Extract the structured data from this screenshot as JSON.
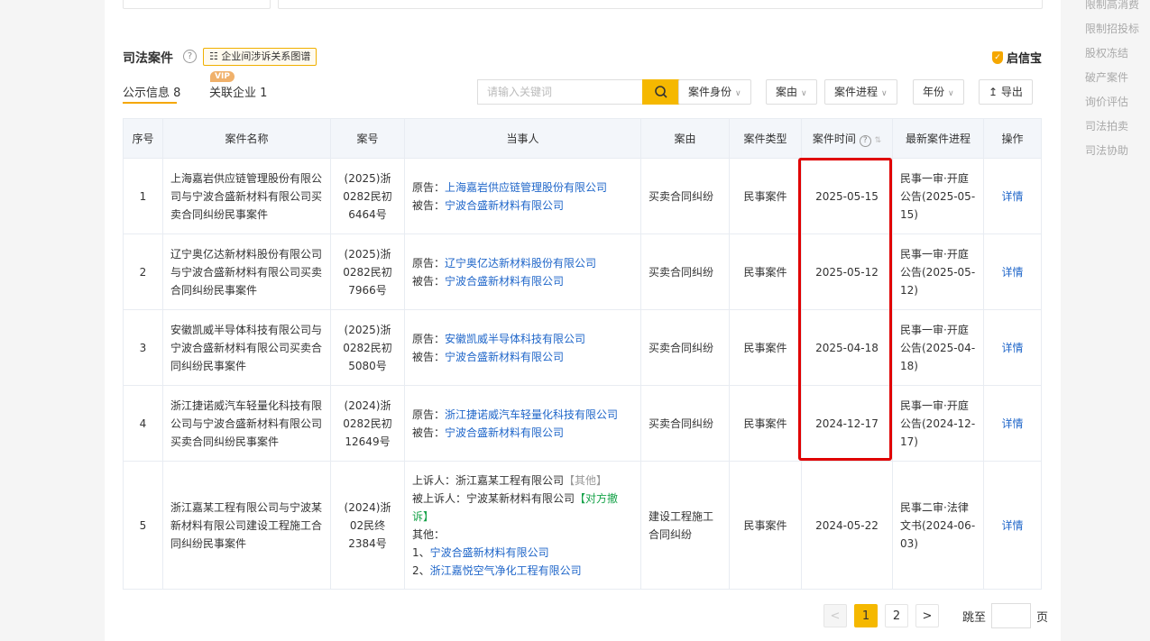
{
  "section": {
    "title": "司法案件",
    "relation_button": "企业间涉诉关系图谱",
    "brand": "启信宝"
  },
  "tabs": [
    {
      "label": "公示信息",
      "count": "8"
    },
    {
      "label": "关联企业",
      "count": "1",
      "badge": "VIP"
    }
  ],
  "search": {
    "placeholder": "请输入关键词"
  },
  "filters": [
    "案件身份",
    "案由",
    "案件进程",
    "年份"
  ],
  "export_label": "导出",
  "table": {
    "headers": [
      "序号",
      "案件名称",
      "案号",
      "当事人",
      "案由",
      "案件类型",
      "案件时间",
      "最新案件进程",
      "操作"
    ],
    "rows": [
      {
        "no": "1",
        "name": "上海嘉岩供应链管理股份有限公司与宁波合盛新材料有限公司买卖合同纠纷民事案件",
        "case_no": "(2025)浙0282民初6464号",
        "plaintiff_label": "原告：",
        "plaintiff": "上海嘉岩供应链管理股份有限公司",
        "defendant_label": "被告：",
        "defendant": "宁波合盛新材料有限公司",
        "cause": "买卖合同纠纷",
        "type": "民事案件",
        "date": "2025-05-15",
        "progress": "民事一审·开庭公告(2025-05-15)",
        "action": "详情"
      },
      {
        "no": "2",
        "name": "辽宁奥亿达新材料股份有限公司与宁波合盛新材料有限公司买卖合同纠纷民事案件",
        "case_no": "(2025)浙0282民初7966号",
        "plaintiff_label": "原告：",
        "plaintiff": "辽宁奥亿达新材料股份有限公司",
        "defendant_label": "被告：",
        "defendant": "宁波合盛新材料有限公司",
        "cause": "买卖合同纠纷",
        "type": "民事案件",
        "date": "2025-05-12",
        "progress": "民事一审·开庭公告(2025-05-12)",
        "action": "详情"
      },
      {
        "no": "3",
        "name": "安徽凯威半导体科技有限公司与宁波合盛新材料有限公司买卖合同纠纷民事案件",
        "case_no": "(2025)浙0282民初5080号",
        "plaintiff_label": "原告：",
        "plaintiff": "安徽凯威半导体科技有限公司",
        "defendant_label": "被告：",
        "defendant": "宁波合盛新材料有限公司",
        "cause": "买卖合同纠纷",
        "type": "民事案件",
        "date": "2025-04-18",
        "progress": "民事一审·开庭公告(2025-04-18)",
        "action": "详情"
      },
      {
        "no": "4",
        "name": "浙江捷诺威汽车轻量化科技有限公司与宁波合盛新材料有限公司买卖合同纠纷民事案件",
        "case_no": "(2024)浙0282民初12649号",
        "plaintiff_label": "原告：",
        "plaintiff": "浙江捷诺威汽车轻量化科技有限公司",
        "defendant_label": "被告：",
        "defendant": "宁波合盛新材料有限公司",
        "cause": "买卖合同纠纷",
        "type": "民事案件",
        "date": "2024-12-17",
        "progress": "民事一审·开庭公告(2024-12-17)",
        "action": "详情"
      },
      {
        "no": "5",
        "name": "浙江嘉某工程有限公司与宁波某新材料有限公司建设工程施工合同纠纷民事案件",
        "case_no": "(2024)浙02民终2384号",
        "appellant_label": "上诉人：",
        "appellant": "浙江嘉某工程有限公司",
        "appellant_tag": "【其他】",
        "appellee_label": "被上诉人：",
        "appellee": "宁波某新材料有限公司",
        "appellee_tag": "【对方撤诉】",
        "others_label": "其他：",
        "other1_prefix": "1、",
        "other1": "宁波合盛新材料有限公司",
        "other2_prefix": "2、",
        "other2": "浙江嘉悦空气净化工程有限公司",
        "cause": "建设工程施工合同纠纷",
        "type": "民事案件",
        "date": "2024-05-22",
        "progress": "民事二审·法律文书(2024-06-03)",
        "action": "详情"
      }
    ]
  },
  "pagination": {
    "prev": "<",
    "pages": [
      "1",
      "2"
    ],
    "next": ">",
    "jump_label": "跳至",
    "page_suffix": "页"
  },
  "sidebar": [
    "限制高消费",
    "限制招投标",
    "股权冻结",
    "破产案件",
    "询价评估",
    "司法拍卖",
    "司法协助"
  ],
  "colors": {
    "accent": "#f5b800",
    "link": "#1f66c9",
    "highlight_box": "#e00000"
  }
}
